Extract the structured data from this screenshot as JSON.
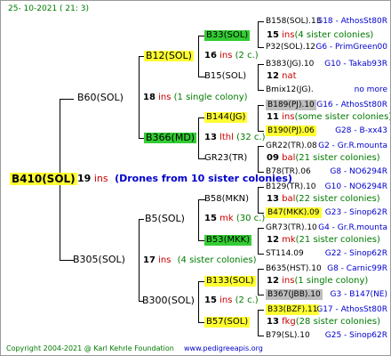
{
  "header": {
    "date": "25- 10-2021 ( 21: 3)"
  },
  "footer": {
    "copyright": "Copyright 2004-2021 @ Karl Kehrle Foundation",
    "site": "www.pedigreeapis.org"
  },
  "root": {
    "name": "B410(SOL)",
    "count": "19",
    "ins": "ins",
    "note": "(Drones from 10 sister colonies)"
  },
  "gen1": [
    {
      "name": "B60(SOL)",
      "count": "18",
      "ins": "ins",
      "note": "(1 single colony)"
    },
    {
      "name": "B305(SOL)",
      "count": "17",
      "ins": "ins",
      "note": "(4 sister colonies)"
    }
  ],
  "gen2": [
    {
      "name": "B12(SOL)",
      "count": "16",
      "ins": "ins",
      "note": "(2 c.)"
    },
    {
      "name": "B366(MD)",
      "count": "13",
      "ins": "lthl",
      "note": "(32 c.)"
    },
    {
      "name": "B5(SOL)",
      "count": "15",
      "ins": "mk",
      "note": "(30 c.)"
    },
    {
      "name": "B300(SOL)",
      "count": "15",
      "ins": "ins",
      "note": "(2 c.)"
    }
  ],
  "gen3": [
    {
      "name": "B33(SOL)",
      "count": "15",
      "ins": "ins",
      "note": "(4 sister colonies)"
    },
    {
      "name": "B15(SOL)",
      "count": "12",
      "ins": "nat",
      "note": ""
    },
    {
      "name": "B144(JG)",
      "count": "11",
      "ins": "ins",
      "note": "(some sister colonies)"
    },
    {
      "name": "GR23(TR)",
      "count": "09",
      "ins": "bal",
      "note": "(21 sister colonies)"
    },
    {
      "name": "B58(MKN)",
      "count": "13",
      "ins": "bal",
      "note": "(22 sister colonies)"
    },
    {
      "name": "B53(MKK)",
      "count": "12",
      "ins": "mk",
      "note": "(21 sister colonies)"
    },
    {
      "name": "B133(SOL)",
      "count": "12",
      "ins": "ins",
      "note": "(1 single colony)"
    },
    {
      "name": "B57(SOL)",
      "count": "13",
      "ins": "fkg",
      "note": "(28 sister colonies)"
    }
  ],
  "gen4": [
    {
      "name": "B158(SOL).13",
      "info": "G18 - AthosSt80R"
    },
    {
      "name": "P32(SOL).12",
      "info": "G6 - PrimGreen00"
    },
    {
      "name": "B383(JG).10",
      "info": "G10 - Takab93R"
    },
    {
      "name": "Bmix12(JG).",
      "info": "no more"
    },
    {
      "name": "B189(PJ).10",
      "info": "G16 - AthosSt80R"
    },
    {
      "name": "B190(PJ).06",
      "info": "G28 - B-xx43"
    },
    {
      "name": "GR22(TR).08",
      "info": "G2 - Gr.R.mounta"
    },
    {
      "name": "B78(TR).06",
      "info": "G8 - NO6294R"
    },
    {
      "name": "B129(TR).10",
      "info": "G10 - NO6294R"
    },
    {
      "name": "B47(MKK).09",
      "info": "G23 - Sinop62R"
    },
    {
      "name": "GR73(TR).10",
      "info": "G4 - Gr.R.mounta"
    },
    {
      "name": "ST114.09",
      "info": "G22 - Sinop62R"
    },
    {
      "name": "B635(HST).10",
      "info": "G8 - Carnic99R"
    },
    {
      "name": "B367(JBB).10",
      "info": "G3 - B147(NE)"
    },
    {
      "name": "B33(BZF).11",
      "info": "G17 - AthosSt80R"
    },
    {
      "name": "B79(SL).10",
      "info": "G25 - Sinop62R"
    }
  ]
}
